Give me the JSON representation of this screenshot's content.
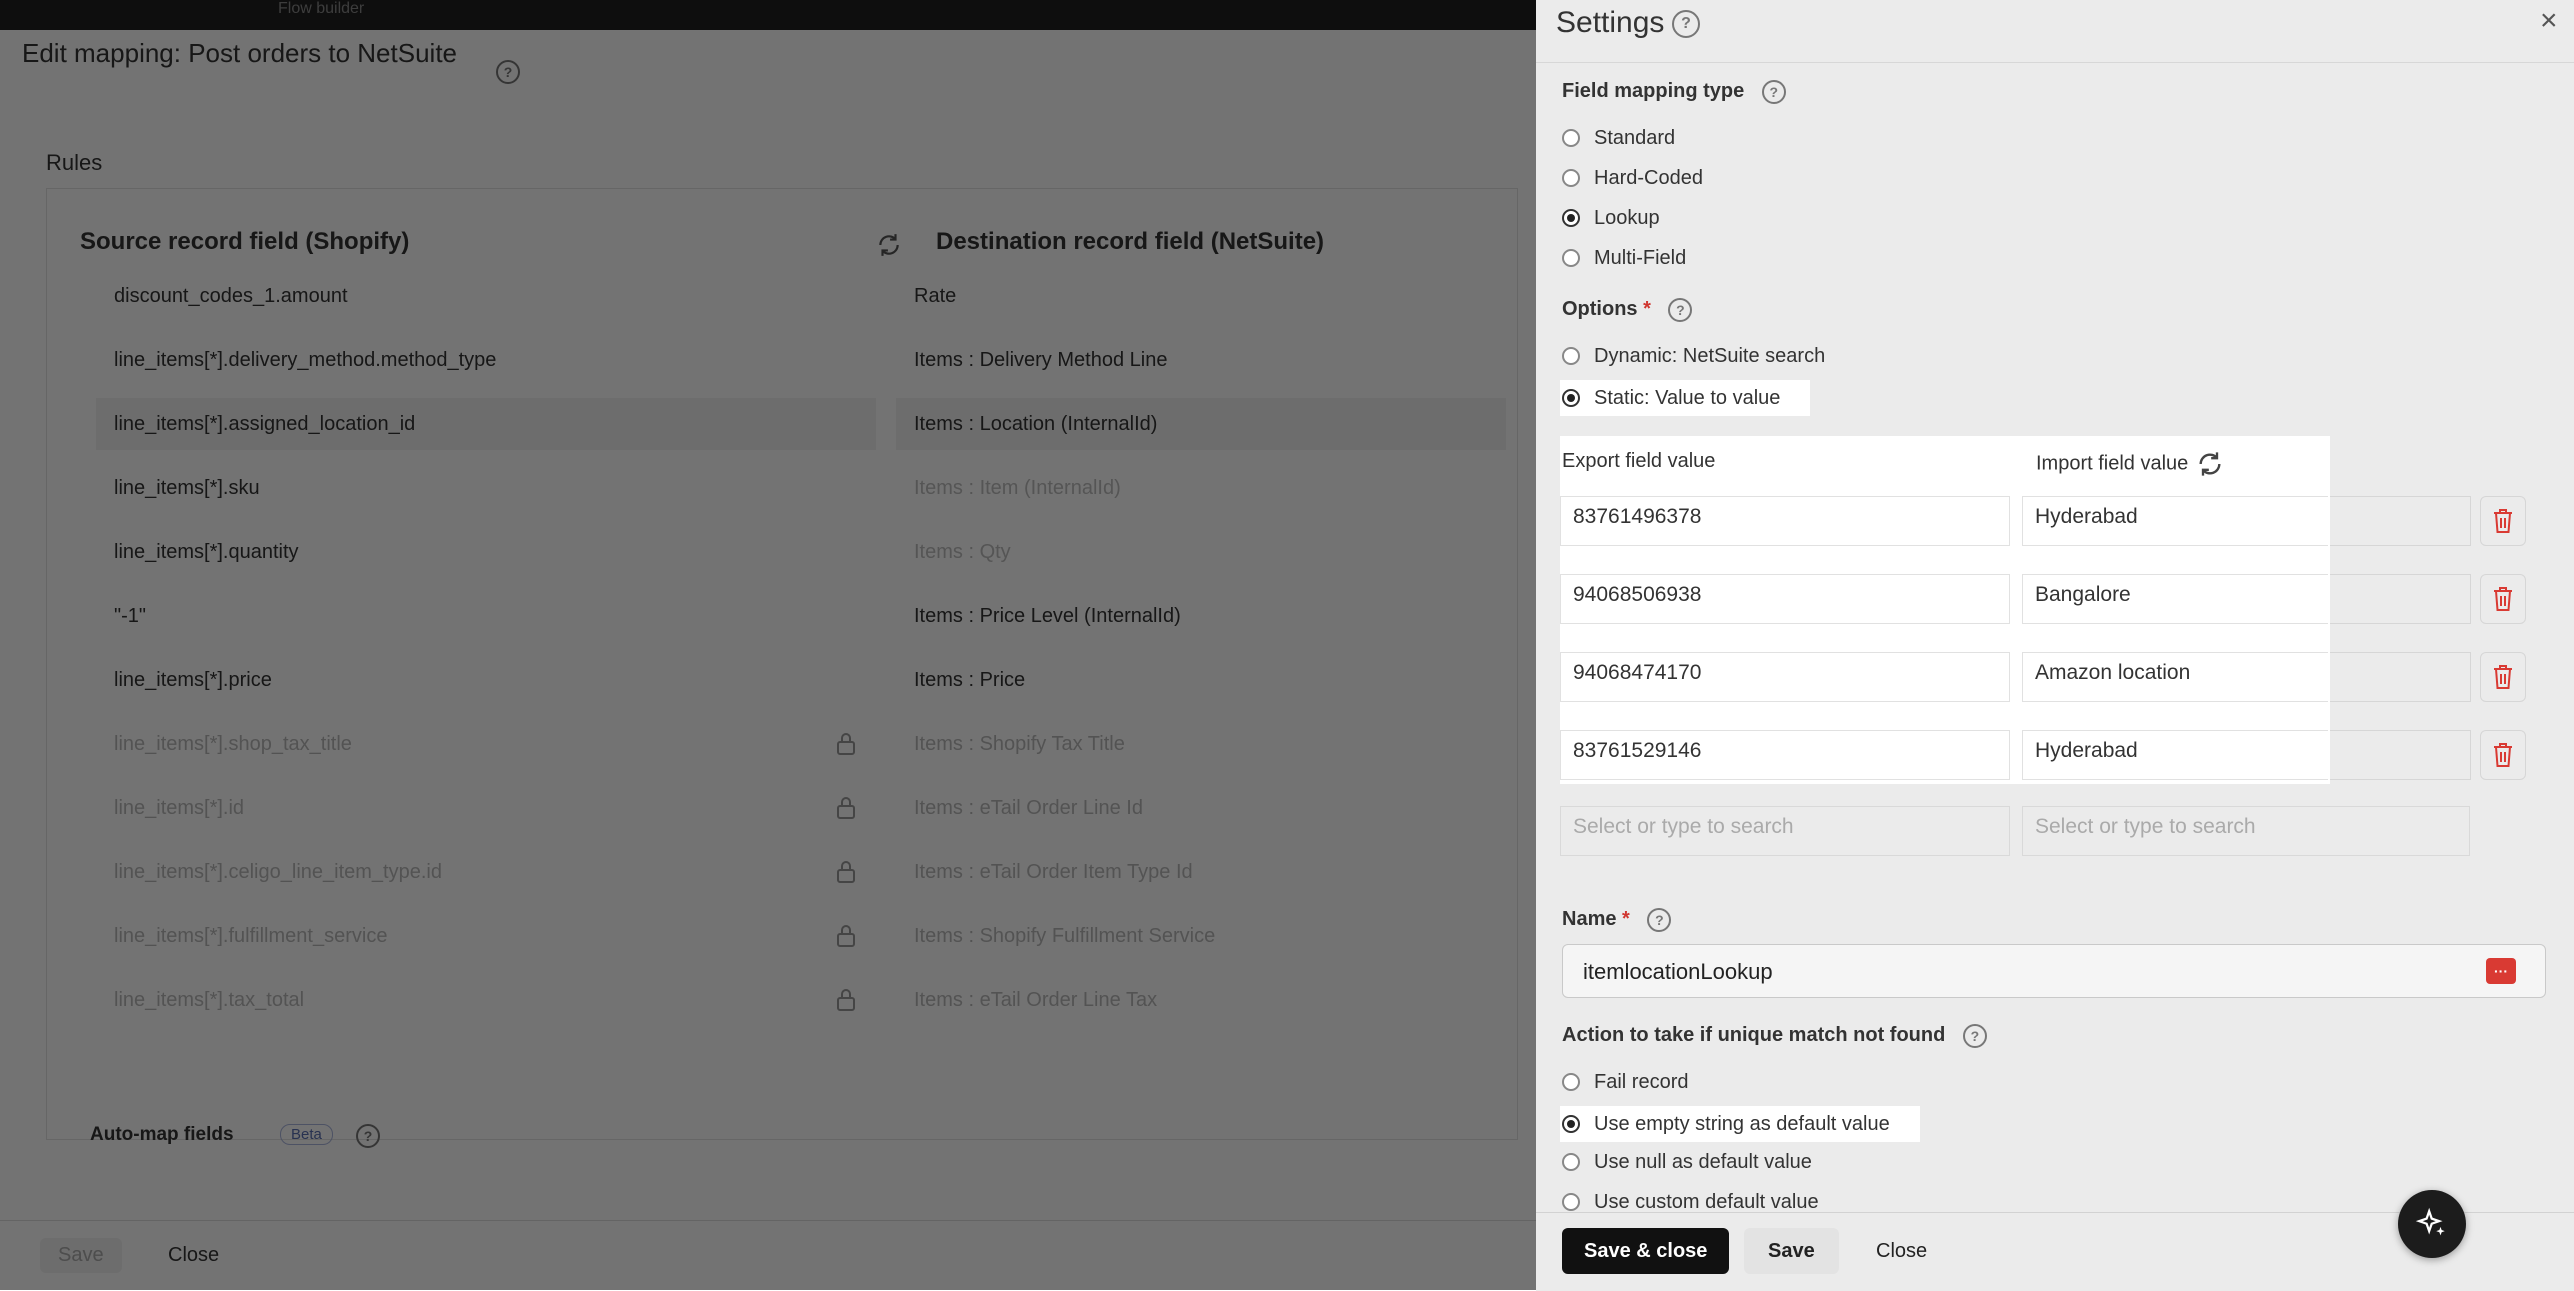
{
  "breadcrumb": {
    "current": "Flow builder"
  },
  "modal": {
    "title": "Edit mapping: Post orders to NetSuite",
    "rules_label": "Rules",
    "source_header": "Source record field (Shopify)",
    "destination_header": "Destination record field (NetSuite)",
    "rows": [
      {
        "source": "discount_codes_1.amount",
        "destination": "Rate"
      },
      {
        "source": "line_items[*].delivery_method.method_type",
        "destination": "Items : Delivery Method Line"
      },
      {
        "source": "line_items[*].assigned_location_id",
        "destination": "Items : Location (InternalId)"
      },
      {
        "source": "line_items[*].sku",
        "destination": "Items : Item (InternalId)"
      },
      {
        "source": "line_items[*].quantity",
        "destination": "Items : Qty"
      },
      {
        "source": "\"-1\"",
        "destination": "Items : Price Level (InternalId)"
      },
      {
        "source": "line_items[*].price",
        "destination": "Items : Price"
      },
      {
        "source": "line_items[*].shop_tax_title",
        "destination": "Items : Shopify Tax Title"
      },
      {
        "source": "line_items[*].id",
        "destination": "Items : eTail Order Line Id"
      },
      {
        "source": "line_items[*].celigo_line_item_type.id",
        "destination": "Items : eTail Order Item Type Id"
      },
      {
        "source": "line_items[*].fulfillment_service",
        "destination": "Items : Shopify Fulfillment Service"
      },
      {
        "source": "line_items[*].tax_total",
        "destination": "Items : eTail Order Line Tax"
      }
    ],
    "automap_label": "Auto-map fields",
    "beta_label": "Beta",
    "save_label": "Save",
    "close_label": "Close"
  },
  "settings": {
    "title": "Settings",
    "field_mapping_type_label": "Field mapping type",
    "field_mapping_types": [
      {
        "label": "Standard",
        "selected": false
      },
      {
        "label": "Hard-Coded",
        "selected": false
      },
      {
        "label": "Lookup",
        "selected": true
      },
      {
        "label": "Multi-Field",
        "selected": false
      }
    ],
    "options_label": "Options",
    "options": [
      {
        "label": "Dynamic: NetSuite search",
        "selected": false
      },
      {
        "label": "Static: Value to value",
        "selected": true
      }
    ],
    "lookup_table": {
      "export_header": "Export field value",
      "import_header": "Import field value",
      "rows": [
        {
          "export": "83761496378",
          "import": "Hyderabad"
        },
        {
          "export": "94068506938",
          "import": "Bangalore"
        },
        {
          "export": "94068474170",
          "import": "Amazon location"
        },
        {
          "export": "83761529146",
          "import": "Hyderabad"
        }
      ],
      "export_placeholder": "Select or type to search",
      "import_placeholder": "Select or type to search"
    },
    "name_label": "Name",
    "name_value": "itemlocationLookup",
    "action_label": "Action to take if unique match not found",
    "actions": [
      {
        "label": "Fail record",
        "selected": false
      },
      {
        "label": "Use empty string as default value",
        "selected": true
      },
      {
        "label": "Use null as default value",
        "selected": false
      },
      {
        "label": "Use custom default value",
        "selected": false
      }
    ],
    "save_close_label": "Save & close",
    "save_label": "Save",
    "close_label": "Close"
  },
  "colors": {
    "accent_dark": "#111111",
    "danger": "#d93a33",
    "overlay": "rgba(0,0,0,0.55)"
  }
}
